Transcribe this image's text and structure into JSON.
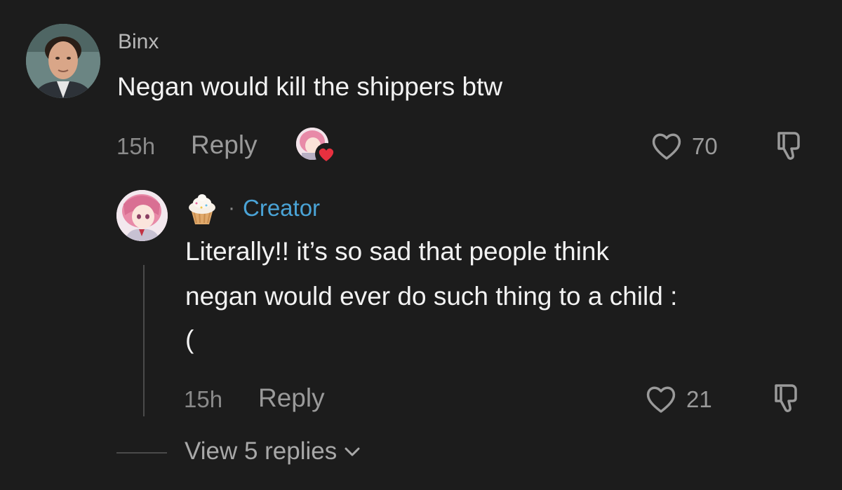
{
  "comment": {
    "author": "Binx",
    "text": "Negan would kill the shippers btw",
    "time": "15h",
    "reply_label": "Reply",
    "likes": "70",
    "liked_by_creator": true
  },
  "reply": {
    "author_emoji": "🧁",
    "separator": "·",
    "creator_badge": "Creator",
    "text_line1": "Literally!! it’s so sad that people think",
    "text_line2": "negan would ever do such thing to a child :",
    "text_line3": "(",
    "time": "15h",
    "reply_label": "Reply",
    "likes": "21"
  },
  "view_replies": {
    "label": "View 5 replies"
  },
  "colors": {
    "background": "#1c1c1c",
    "text": "#f2f2f2",
    "meta": "#8a8a8a",
    "creator": "#4aa3d6",
    "heart_badge": "#e8303f"
  },
  "icons": [
    "heart-outline-icon",
    "dislike-icon",
    "chevron-down-icon",
    "heart-filled-icon"
  ]
}
